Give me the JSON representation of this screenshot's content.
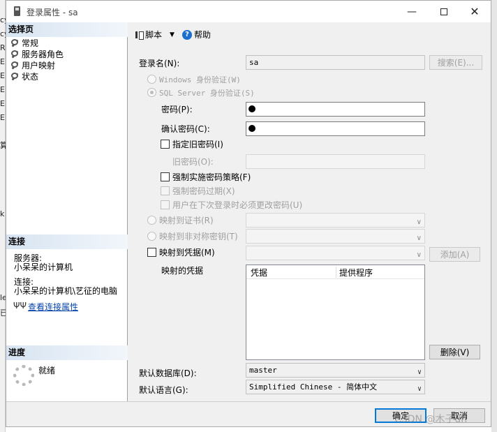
{
  "window": {
    "title": "登录属性 - sa"
  },
  "left": {
    "select_page_header": "选择页",
    "nav_items": [
      "常规",
      "服务器角色",
      "用户映射",
      "状态"
    ],
    "connection_header": "连接",
    "server_label": "服务器:",
    "server_value": "小呆呆的计算机",
    "connection_label": "连接:",
    "connection_value": "小呆呆的计算机\\艺征的电脑",
    "view_connection_link": "查看连接属性",
    "progress_header": "进度",
    "progress_status": "就绪"
  },
  "toolbar": {
    "script_label": "脚本",
    "help_label": "帮助"
  },
  "form": {
    "login_name_label": "登录名(N):",
    "login_name_value": "sa",
    "search_button": "搜索(E)...",
    "windows_auth_label": "Windows 身份验证(W)",
    "sql_auth_label": "SQL Server 身份验证(S)",
    "password_label": "密码(P):",
    "confirm_password_label": "确认密码(C):",
    "specify_old_password_label": "指定旧密码(I)",
    "old_password_label": "旧密码(O):",
    "enforce_policy_label": "强制实施密码策略(F)",
    "enforce_expiration_label": "强制密码过期(X)",
    "must_change_label": "用户在下次登录时必须更改密码(U)",
    "map_cert_label": "映射到证书(R)",
    "map_asym_key_label": "映射到非对称密钥(T)",
    "map_credential_label": "映射到凭据(M)",
    "add_button": "添加(A)",
    "mapped_credentials_label": "映射的凭据",
    "grid_col_credential": "凭据",
    "grid_col_provider": "提供程序",
    "delete_button": "删除(V)",
    "default_db_label": "默认数据库(D):",
    "default_db_value": "master",
    "default_lang_label": "默认语言(G):",
    "default_lang_value": "Simplified Chinese - 简体中文"
  },
  "footer": {
    "ok_button": "确定",
    "cancel_button": "取消"
  },
  "bg_fragments": [
    "cy",
    "cy",
    "R",
    "E",
    "E",
    "E",
    "E",
    "E",
    "算",
    "k",
    "le",
    "已"
  ],
  "watermark": "CSDN @木子dn",
  "colors": {
    "accent": "#0078d7",
    "link": "#0645ad",
    "section_header": "#d7e4f2"
  }
}
